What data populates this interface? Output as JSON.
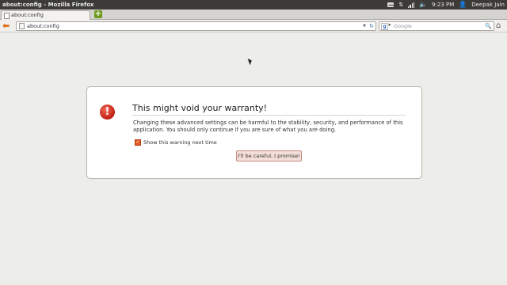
{
  "panel": {
    "window_title": "about:config - Mozilla Firefox",
    "time": "9:23 PM",
    "user": "Deepak Jain"
  },
  "tab": {
    "label": "about:config"
  },
  "navbar": {
    "url": "about:config",
    "search_placeholder": "Google",
    "search_engine_icon": "g"
  },
  "warning": {
    "title": "This might void your warranty!",
    "message": "Changing these advanced settings can be harmful to the stability, security, and performance of this application. You should only continue if you are sure of what you are doing.",
    "checkbox_label": "Show this warning next time",
    "checkbox_checked": true,
    "button_label": "I'll be careful, I promise!",
    "icon_glyph": "!"
  },
  "icons": {
    "back": "back-arrow-icon",
    "reload": "reload-icon",
    "home": "home-icon",
    "search": "magnifier-icon",
    "new_tab": "plus-icon"
  },
  "colors": {
    "accent": "#e25a20",
    "warning_red": "#c01e14",
    "new_tab_green": "#6e9a1e"
  }
}
